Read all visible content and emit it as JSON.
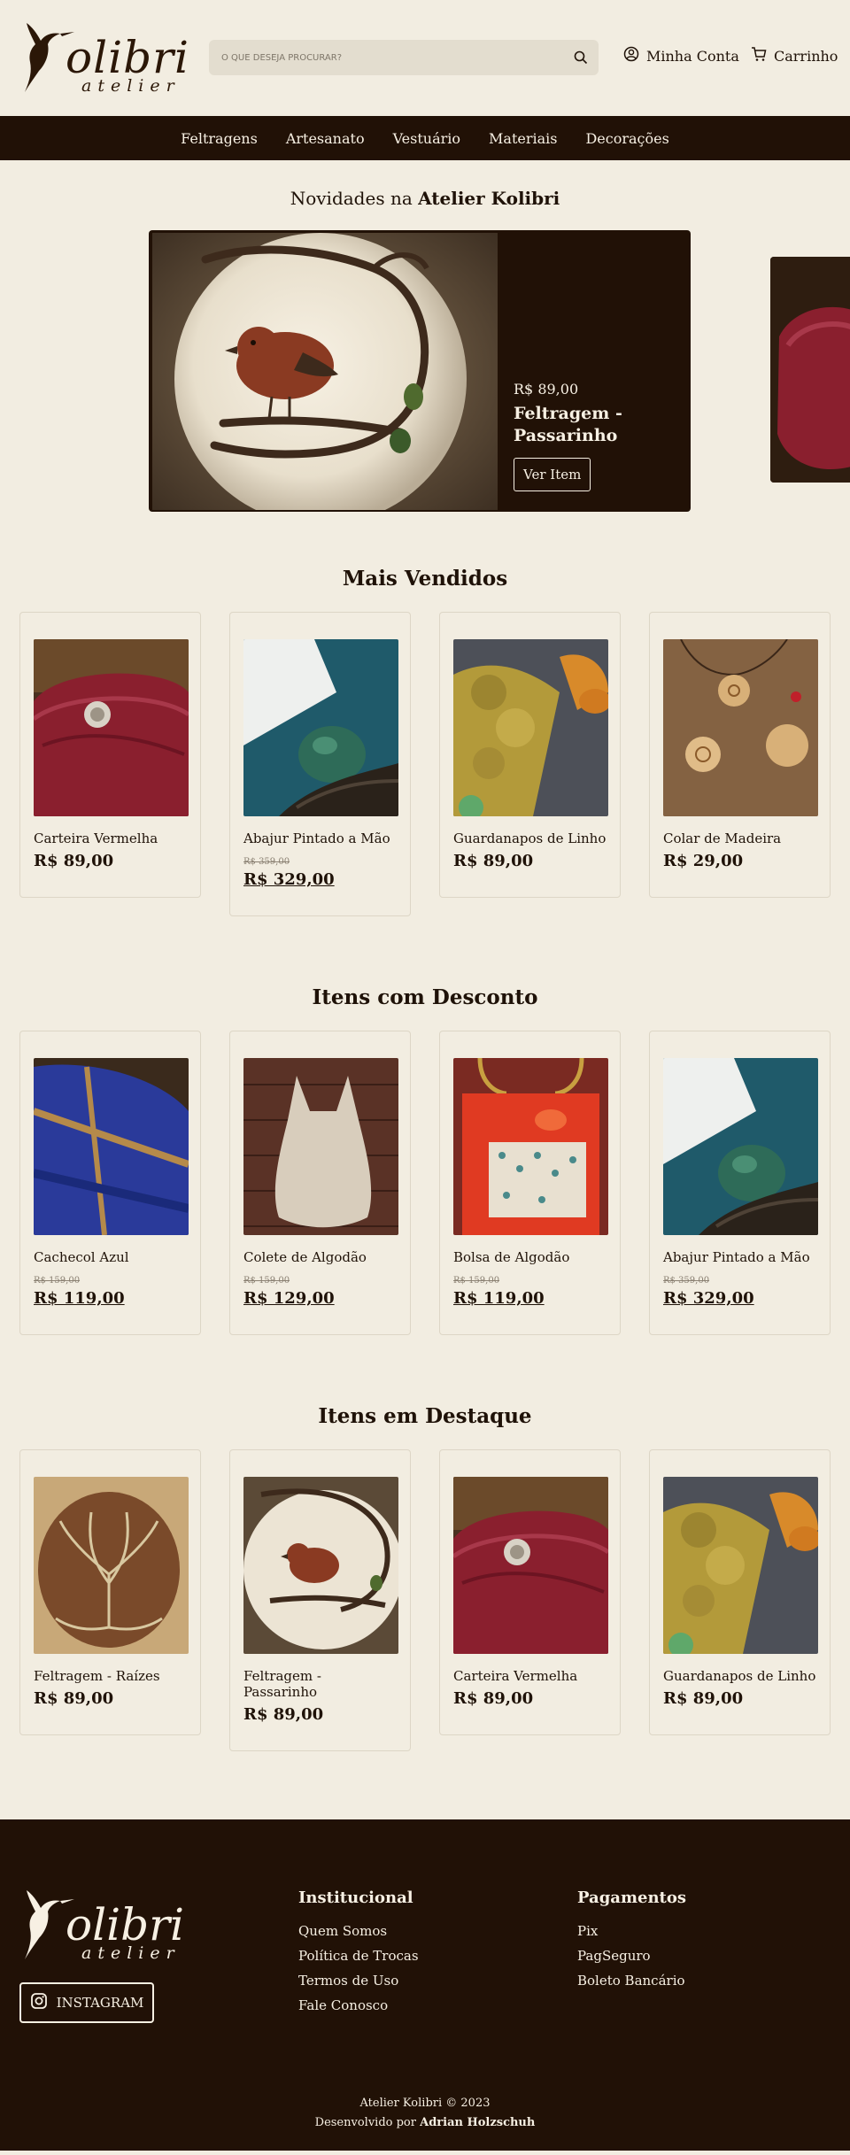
{
  "header": {
    "logo_text": "olibri",
    "logo_sub": "atelier",
    "search_placeholder": "O QUE DESEJA PROCURAR?",
    "account_label": "Minha Conta",
    "cart_label": "Carrinho"
  },
  "nav": {
    "items": [
      {
        "label": "Feltragens"
      },
      {
        "label": "Artesanato"
      },
      {
        "label": "Vestuário"
      },
      {
        "label": "Materiais"
      },
      {
        "label": "Decorações"
      }
    ]
  },
  "novidades": {
    "title_prefix": "Novidades na",
    "title_bold": "Atelier Kolibri",
    "slide": {
      "price": "R$ 89,00",
      "name": "Feltragem - Passarinho",
      "button": "Ver Item"
    }
  },
  "mais_vendidos": {
    "title": "Mais Vendidos",
    "items": [
      {
        "name": "Carteira Vermelha",
        "price": "R$ 89,00",
        "old": ""
      },
      {
        "name": "Abajur Pintado a Mão",
        "price": "R$ 329,00",
        "old": "R$ 359,00"
      },
      {
        "name": "Guardanapos de Linho",
        "price": "R$ 89,00",
        "old": ""
      },
      {
        "name": "Colar de Madeira",
        "price": "R$ 29,00",
        "old": ""
      }
    ]
  },
  "desconto": {
    "title": "Itens com Desconto",
    "items": [
      {
        "name": "Cachecol Azul",
        "price": "R$ 119,00",
        "old": "R$ 159,00"
      },
      {
        "name": "Colete de Algodão",
        "price": "R$ 129,00",
        "old": "R$ 159,00"
      },
      {
        "name": "Bolsa de Algodão",
        "price": "R$ 119,00",
        "old": "R$ 159,00"
      },
      {
        "name": "Abajur Pintado a Mão",
        "price": "R$ 329,00",
        "old": "R$ 359,00"
      }
    ]
  },
  "destaque": {
    "title": "Itens em Destaque",
    "items": [
      {
        "name": "Feltragem - Raízes",
        "price": "R$ 89,00",
        "old": ""
      },
      {
        "name": "Feltragem - Passarinho",
        "price": "R$ 89,00",
        "old": ""
      },
      {
        "name": "Carteira Vermelha",
        "price": "R$ 89,00",
        "old": ""
      },
      {
        "name": "Guardanapos de Linho",
        "price": "R$ 89,00",
        "old": ""
      }
    ]
  },
  "footer": {
    "instagram": "INSTAGRAM",
    "institucional": {
      "title": "Institucional",
      "links": [
        "Quem Somos",
        "Política de Trocas",
        "Termos de Uso",
        "Fale Conosco"
      ]
    },
    "pagamentos": {
      "title": "Pagamentos",
      "links": [
        "Pix",
        "PagSeguro",
        "Boleto Bancário"
      ]
    },
    "copyright": "Atelier Kolibri © 2023",
    "dev_prefix": "Desenvolvido por",
    "dev_name": "Adrian Holzschuh"
  },
  "colors": {
    "background": "#f2ede1",
    "dark_brown": "#211106",
    "text_light": "#f7f0e3"
  }
}
